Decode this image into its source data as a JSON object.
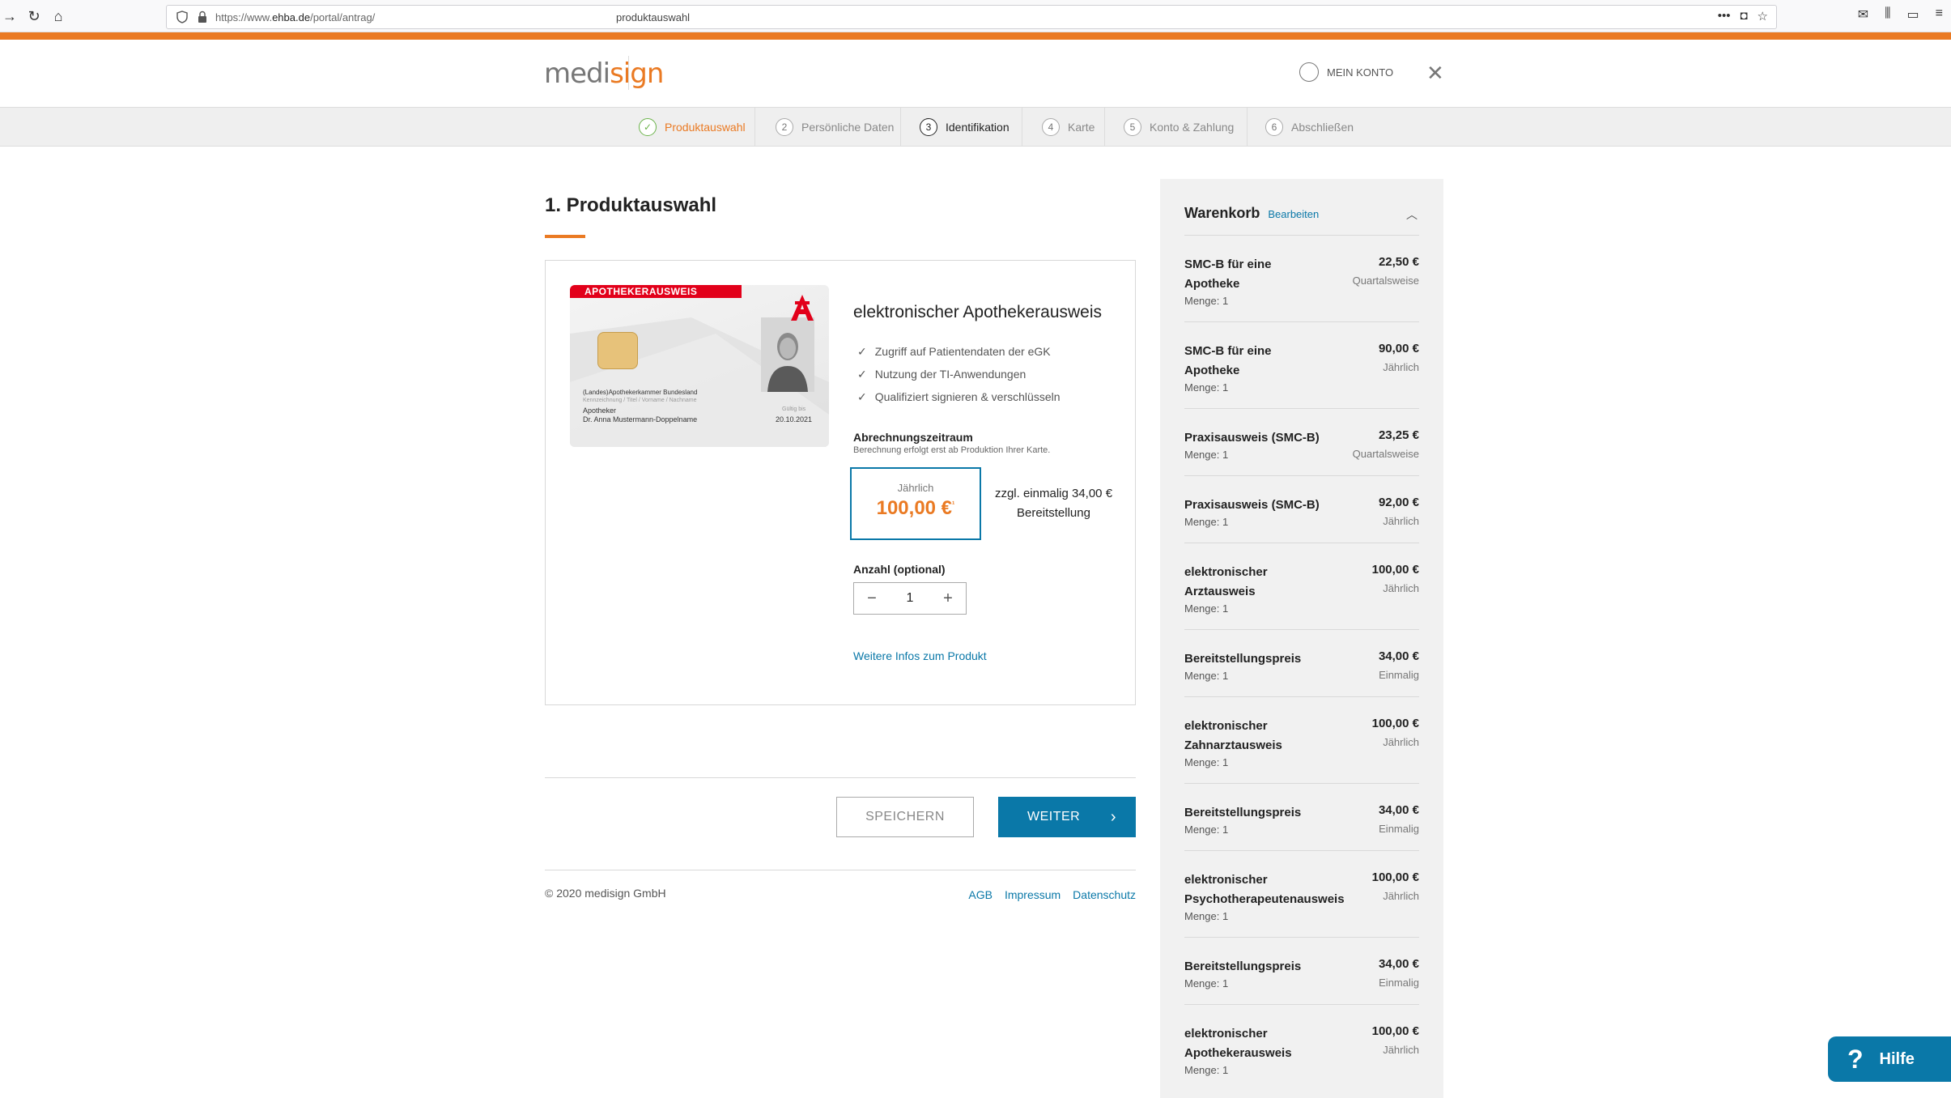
{
  "browser": {
    "url_prefix": "https://www.",
    "url_domain": "ehba.de",
    "url_path": "/portal/antrag/",
    "page_title": "produktauswahl"
  },
  "header": {
    "logo_pre": "medi",
    "logo_o": "sign",
    "account_label": "MEIN KONTO"
  },
  "steps": [
    {
      "num": "1",
      "label": "Produktauswahl",
      "state": "done"
    },
    {
      "num": "2",
      "label": "Persönliche Daten",
      "state": "pending"
    },
    {
      "num": "3",
      "label": "Identifikation",
      "state": "active"
    },
    {
      "num": "4",
      "label": "Karte",
      "state": "pending"
    },
    {
      "num": "5",
      "label": "Konto & Zahlung",
      "state": "pending"
    },
    {
      "num": "6",
      "label": "Abschließen",
      "state": "pending"
    }
  ],
  "main": {
    "title": "1. Produktauswahl",
    "card": {
      "stripe": "APOTHEKERAUSWEIS",
      "chamber": "(Landes)Apothekerkammer Bundesland",
      "fields_hint": "Kennzeichnung / Titel / Vorname / Nachname",
      "profession": "Apotheker",
      "holder": "Dr. Anna Mustermann-Doppelname",
      "valid_label": "Gültig bis",
      "valid_date": "20.10.2021"
    },
    "product_name": "elektronischer Apothekerausweis",
    "features": [
      "Zugriff auf Patientendaten der eGK",
      "Nutzung der TI-Anwendungen",
      "Qualifiziert signieren & verschlüsseln"
    ],
    "billing_title": "Abrechnungszeitraum",
    "billing_sub": "Berechnung erfolgt erst ab Produktion Ihrer Karte.",
    "price_label": "Jährlich",
    "price_amount": "100,00 €",
    "price_sup": "¹",
    "extra_fee": "zzgl. einmalig 34,00 € Bereitstellung",
    "quantity_title": "Anzahl (optional)",
    "quantity_value": "1",
    "more_info": "Weitere Infos zum Produkt",
    "save_label": "SPEICHERN",
    "next_label": "WEITER",
    "copyright": "© 2020 medisign GmbH",
    "footer_links": [
      "AGB",
      "Impressum",
      "Datenschutz"
    ]
  },
  "cart": {
    "title": "Warenkorb",
    "edit_label": "Bearbeiten",
    "qty_prefix": "Menge: ",
    "items": [
      {
        "name": "SMC-B für eine Apotheke",
        "qty": "1",
        "price": "22,50 €",
        "period": "Quartalsweise"
      },
      {
        "name": "SMC-B für eine Apotheke",
        "qty": "1",
        "price": "90,00 €",
        "period": "Jährlich"
      },
      {
        "name": "Praxisausweis (SMC-B)",
        "qty": "1",
        "price": "23,25 €",
        "period": "Quartalsweise"
      },
      {
        "name": "Praxisausweis (SMC-B)",
        "qty": "1",
        "price": "92,00 €",
        "period": "Jährlich"
      },
      {
        "name": "elektronischer Arztausweis",
        "qty": "1",
        "price": "100,00 €",
        "period": "Jährlich"
      },
      {
        "name": "Bereitstellungspreis",
        "qty": "1",
        "price": "34,00 €",
        "period": "Einmalig"
      },
      {
        "name": "elektronischer Zahnarztausweis",
        "qty": "1",
        "price": "100,00 €",
        "period": "Jährlich"
      },
      {
        "name": "Bereitstellungspreis",
        "qty": "1",
        "price": "34,00 €",
        "period": "Einmalig"
      },
      {
        "name": "elektronischer Psychotherapeutenausweis",
        "qty": "1",
        "price": "100,00 €",
        "period": "Jährlich"
      },
      {
        "name": "Bereitstellungspreis",
        "qty": "1",
        "price": "34,00 €",
        "period": "Einmalig"
      },
      {
        "name": "elektronischer Apothekerausweis",
        "qty": "1",
        "price": "100,00 €",
        "period": "Jährlich"
      }
    ]
  },
  "help": {
    "label": "Hilfe",
    "icon": "?"
  },
  "colors": {
    "accent": "#ea7a23",
    "primary": "#0a78a8",
    "success": "#6bb34a"
  }
}
